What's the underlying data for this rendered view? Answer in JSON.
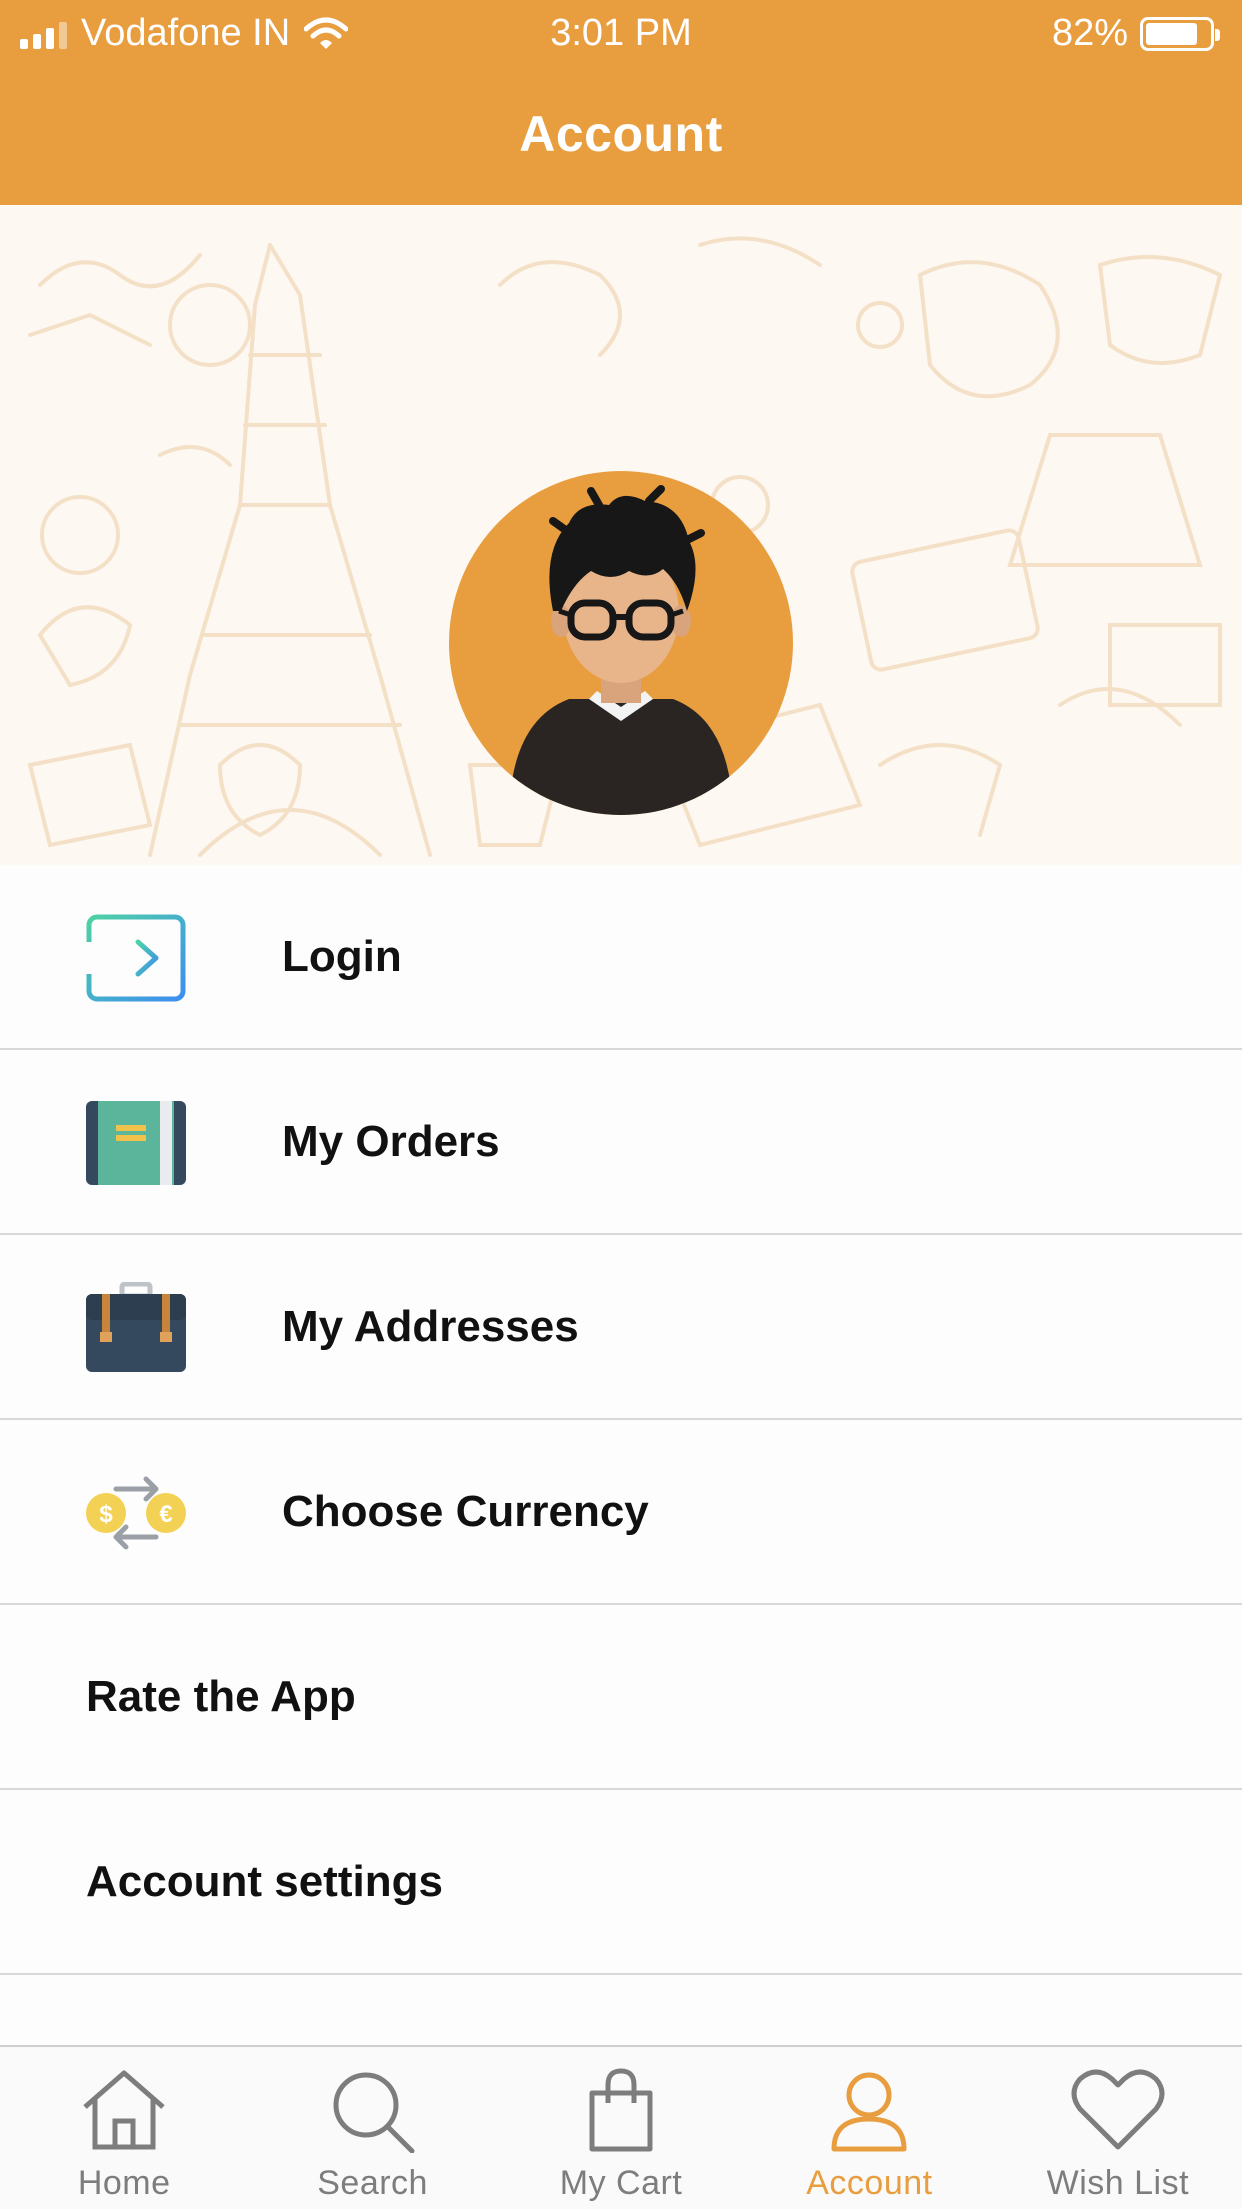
{
  "status_bar": {
    "carrier": "Vodafone IN",
    "time": "3:01 PM",
    "battery": "82%",
    "battery_level": 0.82
  },
  "header": {
    "title": "Account"
  },
  "menu": {
    "items": [
      {
        "label": "Login",
        "icon": "login-icon"
      },
      {
        "label": "My Orders",
        "icon": "orders-book-icon"
      },
      {
        "label": "My Addresses",
        "icon": "briefcase-icon"
      },
      {
        "label": "Choose Currency",
        "icon": "currency-exchange-icon"
      },
      {
        "label": "Rate the App"
      },
      {
        "label": "Account settings"
      }
    ]
  },
  "tabbar": {
    "tabs": [
      {
        "label": "Home",
        "icon": "home-icon"
      },
      {
        "label": "Search",
        "icon": "search-icon"
      },
      {
        "label": "My Cart",
        "icon": "shopping-bag-icon"
      },
      {
        "label": "Account",
        "icon": "user-icon",
        "active": true
      },
      {
        "label": "Wish List",
        "icon": "heart-icon"
      }
    ]
  },
  "colors": {
    "accent": "#e89d3f",
    "tab_inactive": "#7d7d7d"
  }
}
